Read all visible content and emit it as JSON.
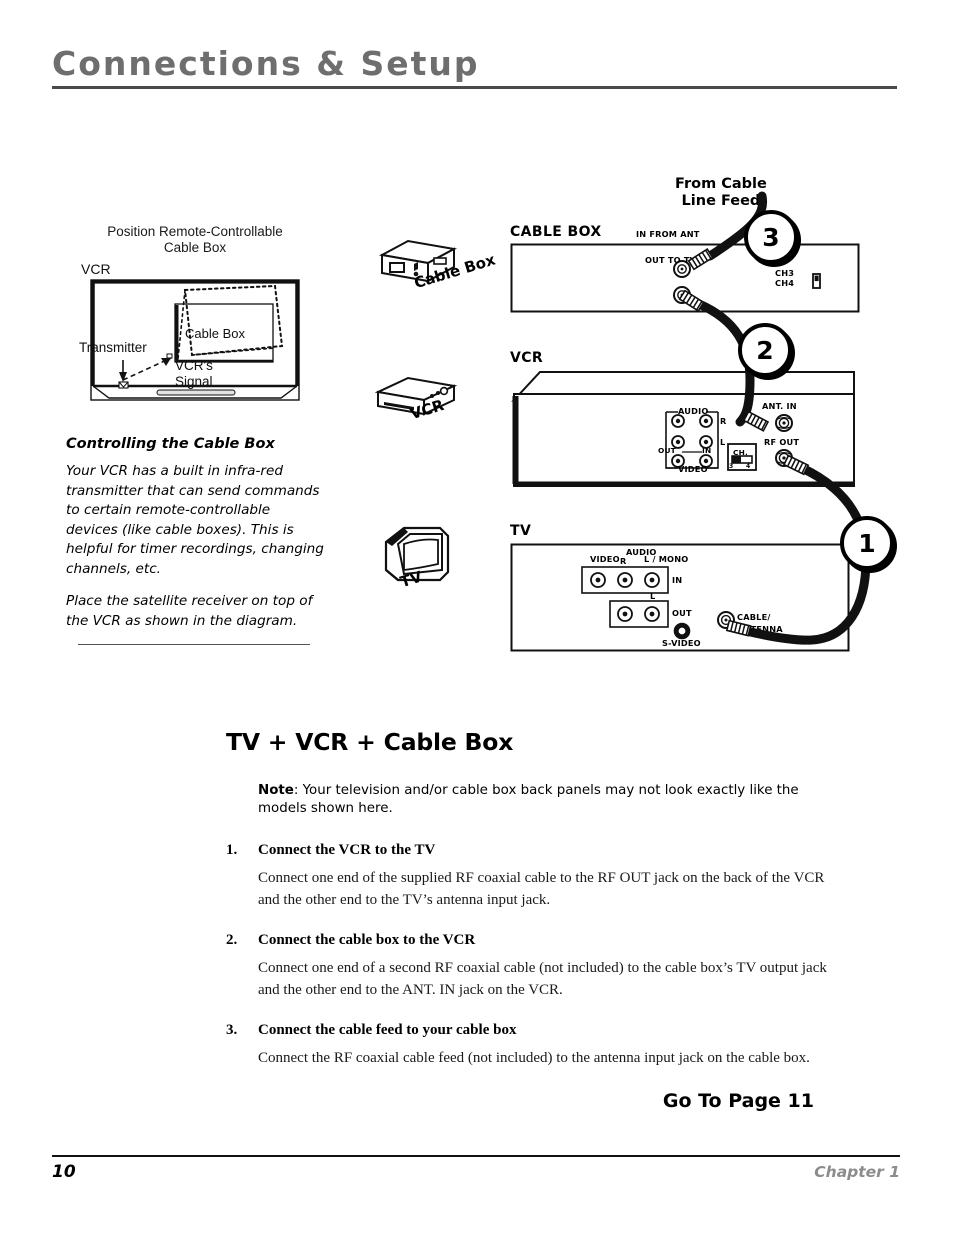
{
  "header": {
    "title": "Connections & Setup"
  },
  "sidebar": {
    "diagram_caption_line1": "Position Remote-Controllable",
    "diagram_caption_line2": "Cable Box",
    "labels": {
      "vcr": "VCR",
      "cable_box": "Cable Box",
      "transmitter": "Transmitter",
      "signal_line1": "VCR's",
      "signal_line2": "Signal"
    },
    "heading": "Controlling the Cable Box",
    "paragraph1": "Your VCR has a built in infra-red transmitter that can send commands to certain remote-controllable devices (like cable boxes).  This is helpful for timer recordings, changing channels, etc.",
    "paragraph2": "Place the satellite receiver on top of the VCR as shown in the diagram."
  },
  "icon_column": {
    "cable_box_label": "Cable Box",
    "vcr_label": "VCR",
    "tv_label": "TV"
  },
  "diagram": {
    "feed_label_line1": "From Cable",
    "feed_label_line2": "Line Feed",
    "cable_box": {
      "title": "CABLE BOX",
      "in_from_ant": "IN FROM ANT",
      "out_to_tv": "OUT TO TV",
      "ch3": "CH3",
      "ch4": "CH4"
    },
    "vcr": {
      "title": "VCR",
      "audio": "AUDIO",
      "video": "VIDEO",
      "out": "OUT",
      "in": "IN",
      "dash": "—",
      "r": "R",
      "l": "L",
      "ant_in": "ANT. IN",
      "rf_out": "RF OUT",
      "ch": "CH.",
      "ch_3": "3",
      "ch_4": "4"
    },
    "tv": {
      "title": "TV",
      "video": "VIDEO",
      "audio": "AUDIO",
      "r": "R",
      "l_mono": "L / MONO",
      "in": "IN",
      "l": "L",
      "out": "OUT",
      "s_video": "S-VIDEO",
      "cable_antenna_line1": "CABLE/",
      "cable_antenna_line2": "ANTENNA"
    },
    "callouts": {
      "one": "1",
      "two": "2",
      "three": "3"
    }
  },
  "main": {
    "heading": "TV + VCR + Cable Box",
    "note_label": "Note",
    "note_text": ": Your television and/or cable box back panels may not look exactly like the models shown here.",
    "steps": [
      {
        "num": "1.",
        "title": "Connect the VCR to the TV",
        "body": "Connect one end of the supplied RF coaxial cable to the RF OUT jack on the back of the VCR and the other end to the TV’s antenna input jack."
      },
      {
        "num": "2.",
        "title": "Connect the cable box to the VCR",
        "body": "Connect one end of a second RF coaxial cable (not included) to the cable box’s TV output jack and the other end to the ANT. IN jack on the VCR."
      },
      {
        "num": "3.",
        "title": "Connect the cable feed to your cable box",
        "body": "Connect the RF coaxial cable feed (not included) to the antenna input jack on the cable box."
      }
    ],
    "goto": "Go To Page 11"
  },
  "footer": {
    "page_number": "10",
    "chapter": "Chapter 1"
  }
}
